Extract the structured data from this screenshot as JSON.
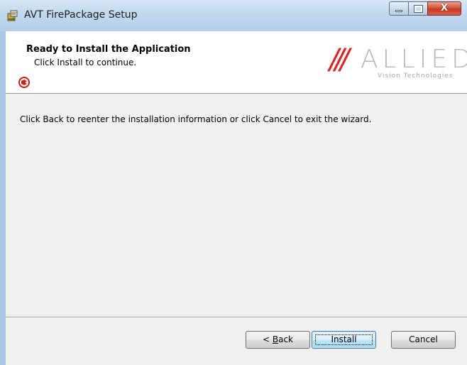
{
  "window": {
    "title": "AVT FirePackage Setup",
    "icon": "installer-package-icon",
    "caption_buttons": {
      "minimize": "minimize-icon",
      "maximize": "maximize-icon",
      "close_glyph": "X"
    }
  },
  "banner": {
    "title": "Ready to Install the Application",
    "subtitle": "Click Install to continue.",
    "badge_icon": "shield-badge-icon",
    "logo": {
      "slashes": "///",
      "word": "ALLIED",
      "tagline": "Vision Technologies"
    }
  },
  "body": {
    "instruction": "Click Back to reenter the installation information or click Cancel to exit the wizard."
  },
  "buttons": {
    "back_prefix": "< ",
    "back_accel": "B",
    "back_rest": "ack",
    "install": "Install",
    "cancel": "Cancel"
  },
  "colors": {
    "brand_red": "#e2211c",
    "logo_gray": "#b9b9b9",
    "frame_blue": "#a9c6e6"
  }
}
